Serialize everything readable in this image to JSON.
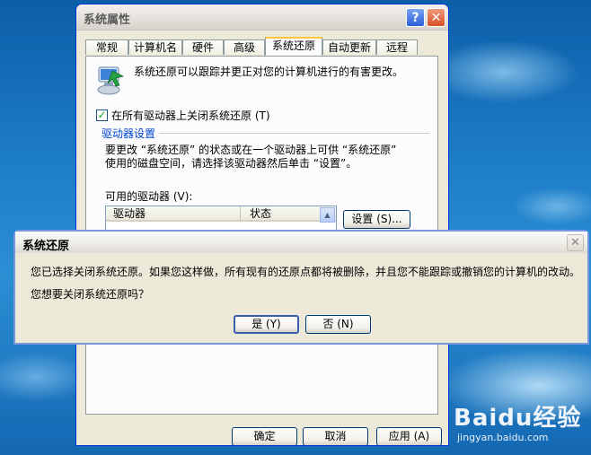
{
  "watermark": {
    "logo": "Baidu经验",
    "url": "jingyan.baidu.com"
  },
  "system_properties": {
    "title": "系统属性",
    "help_glyph": "?",
    "close_glyph": "✕",
    "tabs": [
      {
        "label": "常规"
      },
      {
        "label": "计算机名"
      },
      {
        "label": "硬件"
      },
      {
        "label": "高级"
      },
      {
        "label": "系统还原",
        "active": true
      },
      {
        "label": "自动更新"
      },
      {
        "label": "远程"
      }
    ],
    "description": "系统还原可以跟踪并更正对您的计算机进行的有害更改。",
    "disable_checkbox": {
      "label": "在所有驱动器上关闭系统还原 (T)",
      "checked": true
    },
    "group": {
      "title": "驱动器设置",
      "description_line1": "要更改 “系统还原” 的状态或在一个驱动器上可供 “系统还原”",
      "description_line2": "使用的磁盘空间，请选择该驱动器然后单击 “设置”。",
      "available_label": "可用的驱动器 (V):",
      "columns": [
        "驱动器",
        "状态"
      ],
      "partial_row": [
        "",
        ""
      ],
      "settings_button": "设置 (S)..."
    },
    "buttons": {
      "ok": "确定",
      "cancel": "取消",
      "apply": "应用 (A)"
    }
  },
  "confirm_dialog": {
    "title": "系统还原",
    "close_glyph": "✕",
    "message_line1": "您已选择关闭系统还原。如果您这样做，所有现有的还原点都将被删除，并且您不能跟踪或撤销您的计算机的改动。",
    "message_line2": "您想要关闭系统还原吗？",
    "yes_button": "是 (Y)",
    "no_button": "否 (N)"
  },
  "colors": {
    "accent": "#0046d5",
    "tab_highlight": "#ffc83c",
    "check": "#21a121"
  }
}
